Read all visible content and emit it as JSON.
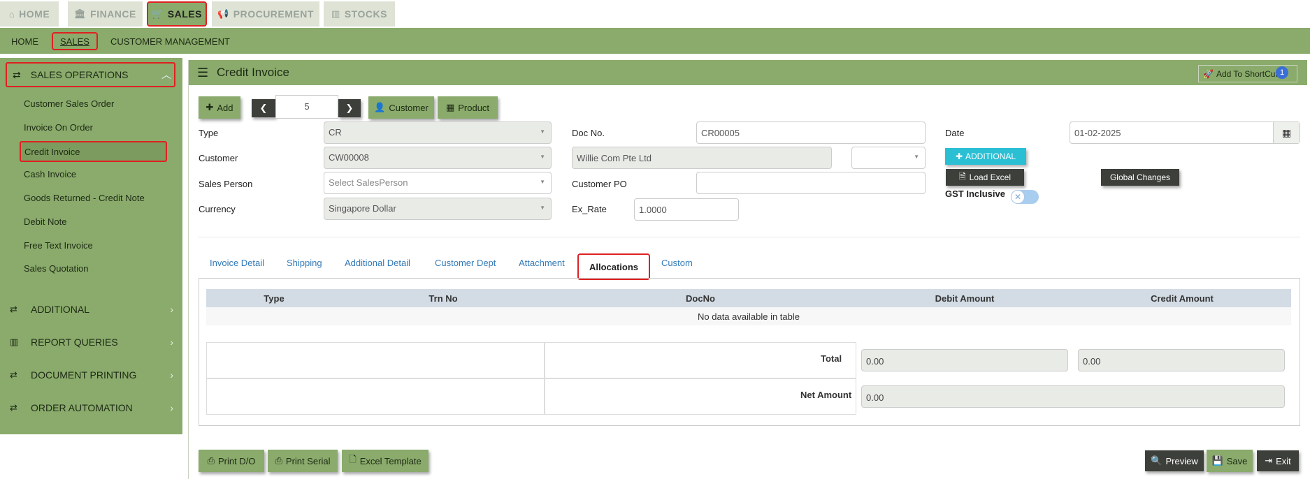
{
  "top_tabs": [
    {
      "label": "HOME",
      "icon": "home-icon"
    },
    {
      "label": "FINANCE",
      "icon": "bank-icon"
    },
    {
      "label": "SALES",
      "icon": "cart-icon"
    },
    {
      "label": "PROCUREMENT",
      "icon": "megaphone-icon"
    },
    {
      "label": "STOCKS",
      "icon": "bar-chart-icon"
    }
  ],
  "sub_nav": [
    "HOME",
    "SALES",
    "CUSTOMER MANAGEMENT"
  ],
  "sidebar": {
    "section_title": "SALES OPERATIONS",
    "items": [
      "Customer Sales Order",
      "Invoice On Order",
      "Credit Invoice",
      "Cash Invoice",
      "Goods Returned - Credit Note",
      "Debit Note",
      "Free Text Invoice",
      "Sales Quotation"
    ],
    "groups": [
      "ADDITIONAL",
      "REPORT QUERIES",
      "DOCUMENT PRINTING",
      "ORDER AUTOMATION"
    ]
  },
  "header": {
    "title": "Credit Invoice",
    "shortcut_label": "Add To ShortCut",
    "shortcut_badge": "1"
  },
  "toolbar": {
    "add_label": "Add",
    "record_number": "5",
    "customer_label": "Customer",
    "product_label": "Product"
  },
  "form": {
    "type_label": "Type",
    "type_value": "CR",
    "customer_label": "Customer",
    "customer_value": "CW00008",
    "sales_person_label": "Sales Person",
    "sales_person_placeholder": "Select SalesPerson",
    "currency_label": "Currency",
    "currency_value": "Singapore Dollar",
    "doc_no_label": "Doc No.",
    "doc_no_value": "CR00005",
    "customer_name_value": "Willie Com Pte Ltd",
    "customer_po_label": "Customer PO",
    "ex_rate_label": "Ex_Rate",
    "ex_rate_value": "1.0000",
    "date_label": "Date",
    "date_value": "01-02-2025",
    "additional_label": "ADDITIONAL",
    "load_excel_label": "Load Excel",
    "global_changes_label": "Global Changes",
    "gst_label": "GST Inclusive"
  },
  "tabs": [
    "Invoice Detail",
    "Shipping",
    "Additional Detail",
    "Customer Dept",
    "Attachment",
    "Allocations",
    "Custom"
  ],
  "allocations": {
    "columns": [
      "Type",
      "Trn No",
      "DocNo",
      "Debit Amount",
      "Credit Amount"
    ],
    "empty_message": "No data available in table",
    "total_label": "Total",
    "total_debit": "0.00",
    "total_credit": "0.00",
    "net_amount_label": "Net Amount",
    "net_amount": "0.00"
  },
  "footer": {
    "print_do_label": "Print D/O",
    "print_serial_label": "Print Serial",
    "excel_template_label": "Excel Template",
    "preview_label": "Preview",
    "save_label": "Save",
    "exit_label": "Exit"
  },
  "colors": {
    "accent_green": "#8aab6c",
    "highlight_red": "#e02020",
    "link_blue": "#337ab7",
    "cyan": "#2bbfd4",
    "dark_button": "#3c3f3a"
  }
}
